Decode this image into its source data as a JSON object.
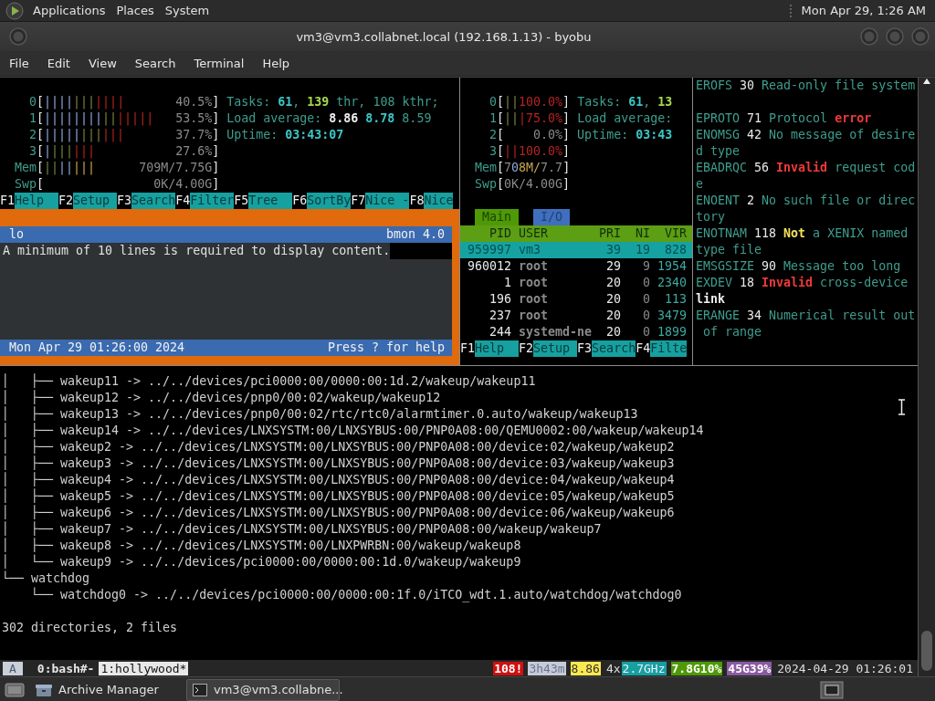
{
  "top_panel": {
    "menus": [
      "Applications",
      "Places",
      "System"
    ],
    "clock": "Mon Apr 29, 1:26 AM"
  },
  "window": {
    "title": "vm3@vm3.collabnet.local (192.168.1.13) - byobu"
  },
  "menu_bar": [
    "File",
    "Edit",
    "View",
    "Search",
    "Terminal",
    "Help"
  ],
  "htop_left": {
    "lines": [
      {
        "kind": "text",
        "segments": [
          {
            "text": "    0",
            "kind": "label"
          },
          {
            "text": "[",
            "kind": "bright"
          },
          {
            "text": "||||",
            "kind": "bar-blue"
          },
          {
            "text": "|||",
            "kind": "bar-green"
          },
          {
            "text": "||||",
            "kind": "bar-red"
          },
          {
            "text": "       40.5%",
            "kind": "dim"
          },
          {
            "text": "]",
            "kind": "bright"
          },
          {
            "text": " Tasks: ",
            "kind": "label"
          },
          {
            "text": "61",
            "kind": "cyan"
          },
          {
            "text": ", ",
            "kind": "label"
          },
          {
            "text": "139",
            "kind": "green"
          },
          {
            "text": " thr, 108 kthr;",
            "kind": "label"
          }
        ]
      },
      {
        "kind": "text",
        "segments": [
          {
            "text": "    1",
            "kind": "label"
          },
          {
            "text": "[",
            "kind": "bright"
          },
          {
            "text": "||||||||",
            "kind": "bar-blue"
          },
          {
            "text": "||",
            "kind": "bar-green"
          },
          {
            "text": "|||||",
            "kind": "bar-red"
          },
          {
            "text": "   53.5%",
            "kind": "dim"
          },
          {
            "text": "]",
            "kind": "bright"
          },
          {
            "text": " Load average: ",
            "kind": "label"
          },
          {
            "text": "8.86",
            "kind": "bold"
          },
          {
            "text": " 8.78",
            "kind": "cyan"
          },
          {
            "text": " 8.59",
            "kind": "label"
          }
        ]
      },
      {
        "kind": "text",
        "segments": [
          {
            "text": "    2",
            "kind": "label"
          },
          {
            "text": "[",
            "kind": "bright"
          },
          {
            "text": "|||||",
            "kind": "bar-blue"
          },
          {
            "text": "|||",
            "kind": "bar-green"
          },
          {
            "text": "|||",
            "kind": "bar-red"
          },
          {
            "text": "       37.7%",
            "kind": "dim"
          },
          {
            "text": "]",
            "kind": "bright"
          },
          {
            "text": " Uptime: ",
            "kind": "label"
          },
          {
            "text": "03:43:07",
            "kind": "cyan"
          }
        ]
      },
      {
        "kind": "text",
        "segments": [
          {
            "text": "    3",
            "kind": "label"
          },
          {
            "text": "[",
            "kind": "bright"
          },
          {
            "text": "|",
            "kind": "bar-blue"
          },
          {
            "text": "|||",
            "kind": "bar-green"
          },
          {
            "text": "|||",
            "kind": "bar-red"
          },
          {
            "text": "           27.6%",
            "kind": "dim"
          },
          {
            "text": "]",
            "kind": "bright"
          }
        ]
      },
      {
        "kind": "text",
        "segments": [
          {
            "text": "  Mem",
            "kind": "label"
          },
          {
            "text": "[",
            "kind": "bright"
          },
          {
            "text": "||",
            "kind": "bar-green"
          },
          {
            "text": "||",
            "kind": "bar-blue"
          },
          {
            "text": "|||",
            "kind": "bar-yellow"
          },
          {
            "text": "      709M/7.75G",
            "kind": "dim"
          },
          {
            "text": "]",
            "kind": "bright"
          }
        ]
      },
      {
        "kind": "text",
        "segments": [
          {
            "text": "  Swp",
            "kind": "label"
          },
          {
            "text": "[",
            "kind": "bright"
          },
          {
            "text": "               0K/4.00G",
            "kind": "dim"
          },
          {
            "text": "]",
            "kind": "bright"
          }
        ]
      }
    ],
    "function_keys": [
      {
        "key": "F1",
        "label": "Help"
      },
      {
        "key": "F2",
        "label": "Setup"
      },
      {
        "key": "F3",
        "label": "Search"
      },
      {
        "key": "F4",
        "label": "Filter"
      },
      {
        "key": "F5",
        "label": "Tree"
      },
      {
        "key": "F6",
        "label": "SortBy"
      },
      {
        "key": "F7",
        "label": "Nice -"
      },
      {
        "key": "F8",
        "label": "Nice"
      }
    ]
  },
  "bmon": {
    "interface": "lo",
    "title": "bmon 4.0",
    "message": "A minimum of 10 lines is required to display content.",
    "timestamp": "Mon Apr 29 01:26:00 2024",
    "help_hint": "Press ? for help"
  },
  "htop_right": {
    "lines": [
      {
        "kind": "text",
        "segments": [
          {
            "text": "    0",
            "kind": "label"
          },
          {
            "text": "[",
            "kind": "bright"
          },
          {
            "text": "||",
            "kind": "bar-green"
          },
          {
            "text": "100.0%",
            "kind": "bar-red"
          },
          {
            "text": "]",
            "kind": "bright"
          },
          {
            "text": " Tasks: ",
            "kind": "label"
          },
          {
            "text": "61",
            "kind": "cyan"
          },
          {
            "text": ", ",
            "kind": "label"
          },
          {
            "text": "13",
            "kind": "green"
          }
        ]
      },
      {
        "kind": "text",
        "segments": [
          {
            "text": "    1",
            "kind": "label"
          },
          {
            "text": "[",
            "kind": "bright"
          },
          {
            "text": "||",
            "kind": "bar-green"
          },
          {
            "text": "|75.0%",
            "kind": "bar-red"
          },
          {
            "text": "]",
            "kind": "bright"
          },
          {
            "text": " Load average:",
            "kind": "label"
          }
        ]
      },
      {
        "kind": "text",
        "segments": [
          {
            "text": "    2",
            "kind": "label"
          },
          {
            "text": "[",
            "kind": "bright"
          },
          {
            "text": "    0.0%",
            "kind": "dim"
          },
          {
            "text": "]",
            "kind": "bright"
          },
          {
            "text": " Uptime: ",
            "kind": "label"
          },
          {
            "text": "03:43",
            "kind": "cyan"
          }
        ]
      },
      {
        "kind": "text",
        "segments": [
          {
            "text": "    3",
            "kind": "label"
          },
          {
            "text": "[",
            "kind": "bright"
          },
          {
            "text": "||100.0%",
            "kind": "bar-red"
          },
          {
            "text": "]",
            "kind": "bright"
          }
        ]
      },
      {
        "kind": "text",
        "segments": [
          {
            "text": "  Mem",
            "kind": "label"
          },
          {
            "text": "[",
            "kind": "bright"
          },
          {
            "text": "7",
            "kind": "dim"
          },
          {
            "text": "0",
            "kind": "bar-blue"
          },
          {
            "text": "8M/",
            "kind": "bar-yellow"
          },
          {
            "text": "7.7",
            "kind": "dim"
          },
          {
            "text": "]",
            "kind": "bright"
          }
        ]
      },
      {
        "kind": "text",
        "segments": [
          {
            "text": "  Swp",
            "kind": "label"
          },
          {
            "text": "[",
            "kind": "bright"
          },
          {
            "text": "0K/4.00G",
            "kind": "dim"
          },
          {
            "text": "]",
            "kind": "bright"
          }
        ]
      }
    ],
    "tabs": [
      {
        "label": "Main",
        "selected": true
      },
      {
        "label": "I/O",
        "selected": false
      }
    ],
    "processes": {
      "columns": [
        "PID",
        "USER",
        "PRI",
        "NI",
        "VIR"
      ],
      "rows": [
        {
          "pid": "959997",
          "user": "vm3",
          "pri": "39",
          "ni": "19",
          "virt": "828",
          "selected": true
        },
        {
          "pid": "960012",
          "user": "root",
          "pri": "29",
          "ni": "9",
          "virt": "1954",
          "selected": false
        },
        {
          "pid": "1",
          "user": "root",
          "pri": "20",
          "ni": "0",
          "virt": "2340",
          "selected": false
        },
        {
          "pid": "196",
          "user": "root",
          "pri": "20",
          "ni": "0",
          "virt": "113",
          "selected": false
        },
        {
          "pid": "237",
          "user": "root",
          "pri": "20",
          "ni": "0",
          "virt": "3479",
          "selected": false
        },
        {
          "pid": "244",
          "user": "systemd-ne",
          "pri": "20",
          "ni": "0",
          "virt": "1899",
          "selected": false
        }
      ]
    },
    "function_keys": [
      {
        "key": "F1",
        "label": "Help"
      },
      {
        "key": "F2",
        "label": "Setup"
      },
      {
        "key": "F3",
        "label": "Search"
      },
      {
        "key": "F4",
        "label": "Filte"
      }
    ]
  },
  "errno": {
    "lines": [
      {
        "kind": "text",
        "segments": [
          {
            "text": "EROFS",
            "kind": "label"
          },
          {
            "text": " 30",
            "kind": "bright"
          },
          {
            "text": " Read-only file system",
            "kind": "label"
          }
        ]
      },
      {
        "kind": "blank"
      },
      {
        "kind": "text",
        "segments": [
          {
            "text": "EPROTO",
            "kind": "label"
          },
          {
            "text": " 71",
            "kind": "bright"
          },
          {
            "text": " Protocol ",
            "kind": "label"
          },
          {
            "text": "error",
            "kind": "red"
          }
        ]
      },
      {
        "kind": "text",
        "segments": [
          {
            "text": "ENOMSG",
            "kind": "label"
          },
          {
            "text": " 42",
            "kind": "bright"
          },
          {
            "text": " No message of desire",
            "kind": "label"
          }
        ]
      },
      {
        "kind": "text",
        "segments": [
          {
            "text": "d type",
            "kind": "label"
          }
        ]
      },
      {
        "kind": "text",
        "segments": [
          {
            "text": "EBADRQC",
            "kind": "label"
          },
          {
            "text": " 56 ",
            "kind": "bright"
          },
          {
            "text": "Invalid",
            "kind": "red"
          },
          {
            "text": " request cod",
            "kind": "label"
          }
        ]
      },
      {
        "kind": "text",
        "segments": [
          {
            "text": "e",
            "kind": "label"
          }
        ]
      },
      {
        "kind": "text",
        "segments": [
          {
            "text": "ENOENT",
            "kind": "label"
          },
          {
            "text": " 2",
            "kind": "bright"
          },
          {
            "text": " No such file or direc",
            "kind": "label"
          }
        ]
      },
      {
        "kind": "text",
        "segments": [
          {
            "text": "tory",
            "kind": "label"
          }
        ]
      },
      {
        "kind": "text",
        "segments": [
          {
            "text": "ENOTNAM",
            "kind": "label"
          },
          {
            "text": " 118 ",
            "kind": "bright"
          },
          {
            "text": "Not",
            "kind": "yellow"
          },
          {
            "text": " a XENIX named",
            "kind": "label"
          }
        ]
      },
      {
        "kind": "text",
        "segments": [
          {
            "text": "type file",
            "kind": "label"
          }
        ]
      },
      {
        "kind": "text",
        "segments": [
          {
            "text": "EMSGSIZE",
            "kind": "label"
          },
          {
            "text": " 90",
            "kind": "bright"
          },
          {
            "text": " Message too long",
            "kind": "label"
          }
        ]
      },
      {
        "kind": "text",
        "segments": [
          {
            "text": "EXDEV",
            "kind": "label"
          },
          {
            "text": " 18 ",
            "kind": "bright"
          },
          {
            "text": "Invalid",
            "kind": "red"
          },
          {
            "text": " cross-device",
            "kind": "label"
          }
        ]
      },
      {
        "kind": "text",
        "segments": [
          {
            "text": "link",
            "kind": "bold"
          }
        ]
      },
      {
        "kind": "text",
        "segments": [
          {
            "text": "ERANGE",
            "kind": "label"
          },
          {
            "text": " 34",
            "kind": "bright"
          },
          {
            "text": " Numerical result out",
            "kind": "label"
          }
        ]
      },
      {
        "kind": "text",
        "segments": [
          {
            "text": " of range",
            "kind": "label"
          }
        ]
      }
    ]
  },
  "tree": {
    "lines": [
      "│   ├── wakeup11 -> ../../devices/pci0000:00/0000:00:1d.2/wakeup/wakeup11",
      "│   ├── wakeup12 -> ../../devices/pnp0/00:02/wakeup/wakeup12",
      "│   ├── wakeup13 -> ../../devices/pnp0/00:02/rtc/rtc0/alarmtimer.0.auto/wakeup/wakeup13",
      "│   ├── wakeup14 -> ../../devices/LNXSYSTM:00/LNXSYBUS:00/PNP0A08:00/QEMU0002:00/wakeup/wakeup14",
      "│   ├── wakeup2 -> ../../devices/LNXSYSTM:00/LNXSYBUS:00/PNP0A08:00/device:02/wakeup/wakeup2",
      "│   ├── wakeup3 -> ../../devices/LNXSYSTM:00/LNXSYBUS:00/PNP0A08:00/device:03/wakeup/wakeup3",
      "│   ├── wakeup4 -> ../../devices/LNXSYSTM:00/LNXSYBUS:00/PNP0A08:00/device:04/wakeup/wakeup4",
      "│   ├── wakeup5 -> ../../devices/LNXSYSTM:00/LNXSYBUS:00/PNP0A08:00/device:05/wakeup/wakeup5",
      "│   ├── wakeup6 -> ../../devices/LNXSYSTM:00/LNXSYBUS:00/PNP0A08:00/device:06/wakeup/wakeup6",
      "│   ├── wakeup7 -> ../../devices/LNXSYSTM:00/LNXSYBUS:00/PNP0A08:00/wakeup/wakeup7",
      "│   ├── wakeup8 -> ../../devices/LNXSYSTM:00/LNXPWRBN:00/wakeup/wakeup8",
      "│   └── wakeup9 -> ../../devices/pci0000:00/0000:00:1d.0/wakeup/wakeup9",
      "└── watchdog",
      "    └── watchdog0 -> ../../devices/pci0000:00/0000:00:1f.0/iTCO_wdt.1.auto/watchdog/watchdog0"
    ],
    "summary": "302 directories, 2 files"
  },
  "status_bar": {
    "session": "A",
    "windows": [
      {
        "label": "0:bash#-",
        "selected": false
      },
      {
        "label": "1:hollywood*",
        "selected": true
      }
    ],
    "indicators": [
      {
        "text": "108!",
        "kind": "alert"
      },
      {
        "text": "3h43m",
        "kind": "uptime"
      },
      {
        "text": "8.86",
        "kind": "load"
      },
      {
        "text": "4x",
        "kind": "plain"
      },
      {
        "text": "2.7GHz",
        "kind": "cpu"
      },
      {
        "text": "7.8G10%",
        "kind": "memory"
      },
      {
        "text": "45G39%",
        "kind": "disk"
      },
      {
        "text": "2024-04-29 01:26:01",
        "kind": "plain"
      }
    ]
  },
  "taskbar": {
    "items": [
      {
        "label": "Archive Manager",
        "kind": "archive",
        "selected": false
      },
      {
        "label": "vm3@vm3.collabne...",
        "kind": "terminal",
        "selected": true
      }
    ]
  }
}
